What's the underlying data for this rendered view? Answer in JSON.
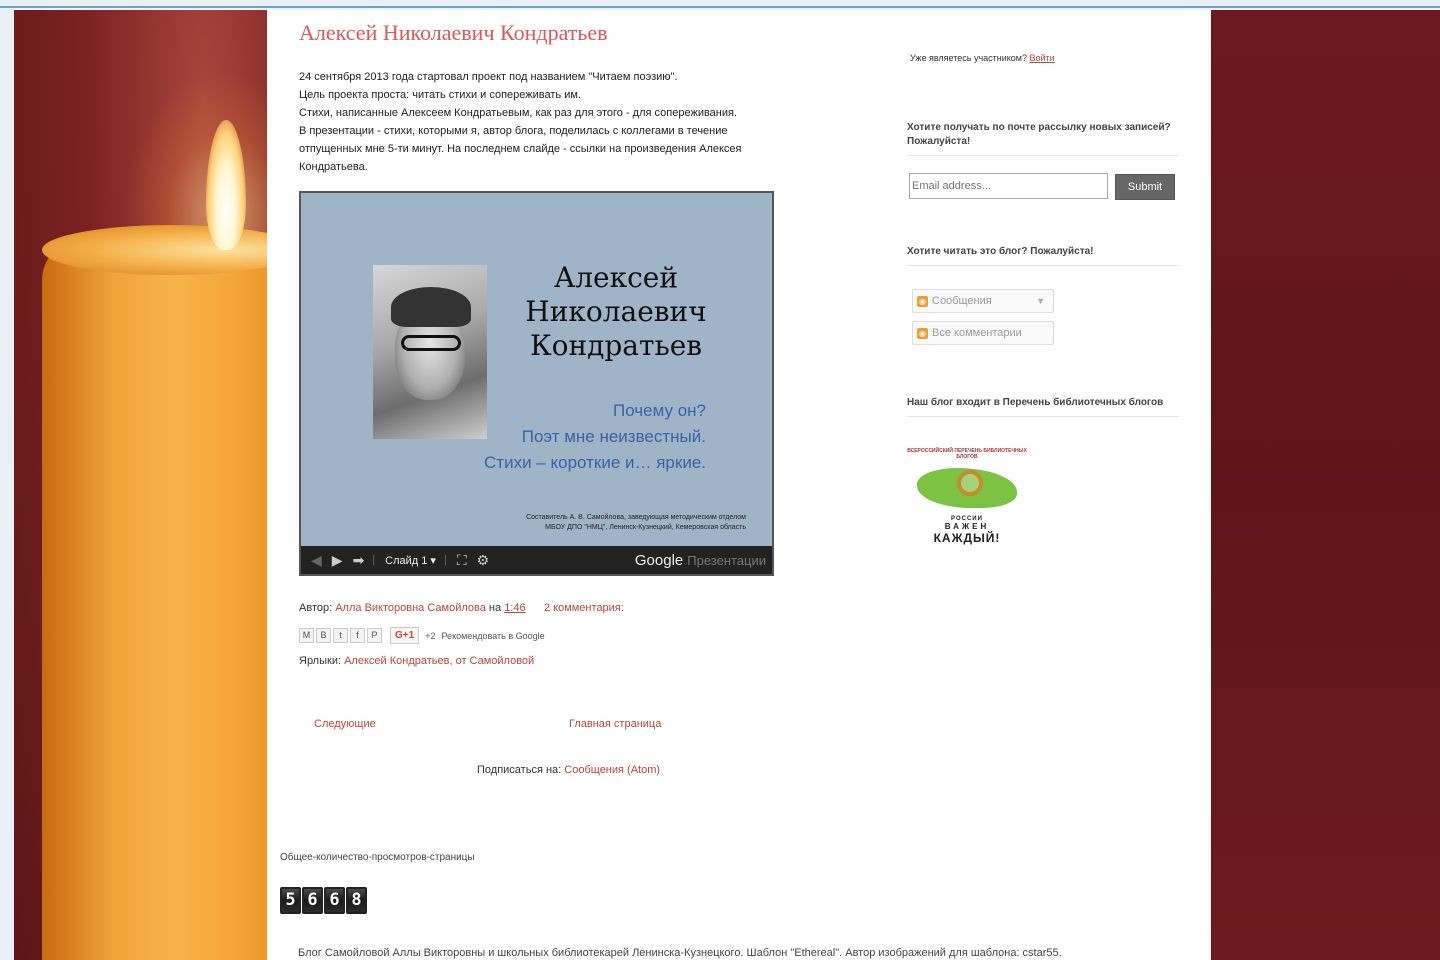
{
  "post": {
    "title": "Алексей Николаевич Кондратьев",
    "paragraphs": [
      "24 сентября 2013 года стартовал проект под названием \"Читаем поэзию\".",
      "Цель проекта проста: читать стихи и сопереживать им.",
      "Стихи, написанные Алексеем Кондратьевым, как раз для этого - для сопереживания.",
      "В презентации - стихи, которыми я, автор блога, поделилась с коллегами в течение",
      "отпущенных мне 5-ти минут. На последнем слайде - ссылки на произведения Алексея",
      "Кондратьева."
    ],
    "slide": {
      "name_lines": [
        "Алексей",
        "Николаевич",
        "Кондратьев"
      ],
      "lines": [
        "Почему он?",
        "Поэт мне неизвестный.",
        "Стихи – короткие и… яркие."
      ],
      "credit_line1": "Составитель А. В. Самойлова, заведующая методическим отделом",
      "credit_line2": "МБОУ ДПО \"НМЦ\", Ленинск-Кузнецкий, Кемеровская область",
      "slide_label": "Слайд 1",
      "google": "Google",
      "presentations": "Презентации"
    },
    "author_prefix": "Автор:",
    "author": "Алла Викторовна Самойлова",
    "at": "на",
    "time": "1:46",
    "comments": "2 комментария:",
    "share": {
      "gplus": "G+1",
      "plus_count": "+2",
      "recommend": "Рекомендовать в Google"
    },
    "labels_prefix": "Ярлыки:",
    "labels": "Алексей Кондратьев, от Самойловой"
  },
  "pager": {
    "next": "Следующие",
    "home": "Главная страница"
  },
  "subscribe": {
    "prefix": "Подписаться на:",
    "link": "Сообщения (Atom)"
  },
  "counter": {
    "title": "Общее-количество-просмотров-страницы",
    "digits": [
      "5",
      "6",
      "6",
      "8"
    ]
  },
  "footer": "Блог Самойловой Аллы Викторовны и школьных библиотекарей Ленинска-Кузнецкого. Шаблон \"Ethereal\". Автор изображений для шаблона: cstar55.",
  "sidebar": {
    "member_prefix": "Уже являетесь участником?",
    "member_login": "Войти",
    "email_title": "Хотите получать по почте рассылку новых записей? Пожалуйста!",
    "email_placeholder": "Email address...",
    "submit": "Submit",
    "read_title": "Хотите читать это блог? Пожалуйста!",
    "feed_posts": "Сообщения",
    "feed_comments": "Все комментарии",
    "catalog_title": "Наш блог входит в Перечень библиотечных блогов",
    "badge": {
      "top": "ВСЕРОССИЙСКИЙ ПЕРЕЧЕНЬ БИБЛИОТЕЧНЫХ БЛОГОВ",
      "line1": "РОССИИ",
      "line2": "ВАЖЕН",
      "line3": "КАЖДЫЙ!"
    }
  },
  "colors": {
    "link": "#c0453c",
    "title": "#e0585b",
    "bg_right": "#6c1a1d"
  }
}
